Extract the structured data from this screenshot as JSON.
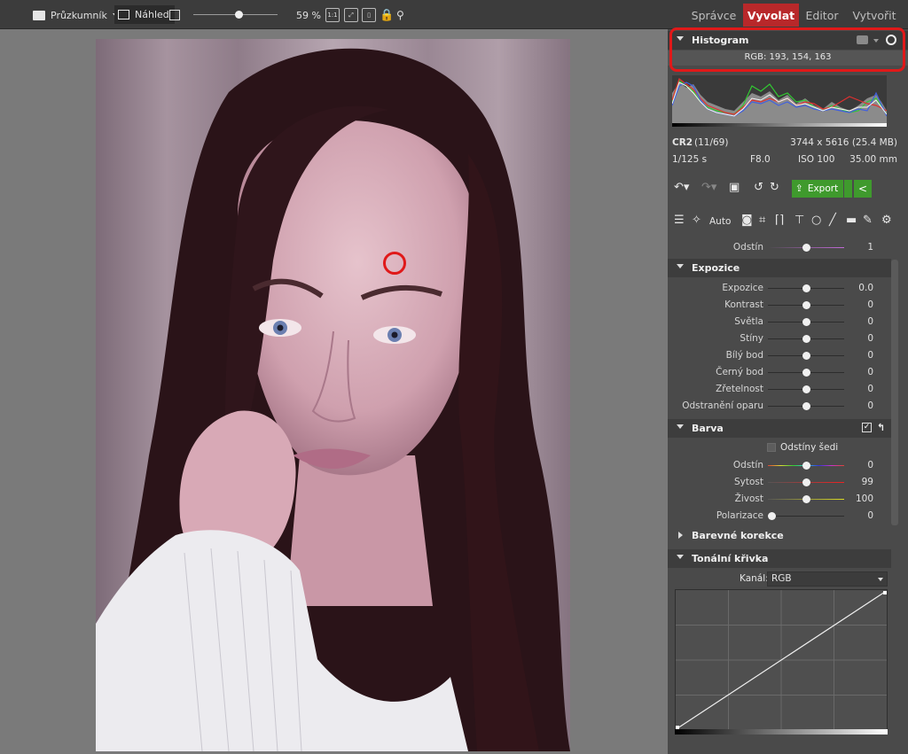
{
  "toolbar": {
    "browser_label": "Průzkumník",
    "preview_label": "Náhled",
    "zoom": "59 %",
    "zoom_fraction": 0.55,
    "one_to_one": "1:1"
  },
  "nav": {
    "tabs": [
      {
        "label": "Správce",
        "active": false
      },
      {
        "label": "Vyvolat",
        "active": true
      },
      {
        "label": "Editor",
        "active": false
      },
      {
        "label": "Vytvořit",
        "active": false
      }
    ]
  },
  "histogram": {
    "title": "Histogram",
    "rgb_readout": "RGB: 193, 154, 163"
  },
  "fileinfo": {
    "format": "CR2",
    "index": "(11/69)",
    "dimensions": "3744 x 5616 (25.4 MB)",
    "shutter": "1/125 s",
    "aperture": "F8.0",
    "iso": "ISO 100",
    "focal": "35.00 mm"
  },
  "actions": {
    "export_label": "Export",
    "auto_label": "Auto"
  },
  "top_slider": {
    "label": "Odstín",
    "value": "1",
    "fraction": 0.5
  },
  "exposure": {
    "title": "Expozice",
    "sliders": [
      {
        "label": "Expozice",
        "value": "0.0",
        "fraction": 0.5
      },
      {
        "label": "Kontrast",
        "value": "0",
        "fraction": 0.5
      },
      {
        "label": "Světla",
        "value": "0",
        "fraction": 0.5
      },
      {
        "label": "Stíny",
        "value": "0",
        "fraction": 0.5
      },
      {
        "label": "Bílý bod",
        "value": "0",
        "fraction": 0.5
      },
      {
        "label": "Černý bod",
        "value": "0",
        "fraction": 0.5
      },
      {
        "label": "Zřetelnost",
        "value": "0",
        "fraction": 0.5
      },
      {
        "label": "Odstranění oparu",
        "value": "0",
        "fraction": 0.5
      }
    ]
  },
  "color": {
    "title": "Barva",
    "grayscale_label": "Odstíny šedi",
    "sliders": [
      {
        "label": "Odstín",
        "value": "0",
        "fraction": 0.5
      },
      {
        "label": "Sytost",
        "value": "99",
        "fraction": 0.5
      },
      {
        "label": "Živost",
        "value": "100",
        "fraction": 0.5
      },
      {
        "label": "Polarizace",
        "value": "0",
        "fraction": 0.05
      }
    ]
  },
  "color_corrections": {
    "title": "Barevné korekce"
  },
  "tone_curve": {
    "title": "Tonální křivka",
    "channel_label": "Kanál:",
    "channel_value": "RGB"
  },
  "colors": {
    "accent": "#b8282a",
    "export_green": "#3f9a2d",
    "highlight": "#e01919"
  }
}
